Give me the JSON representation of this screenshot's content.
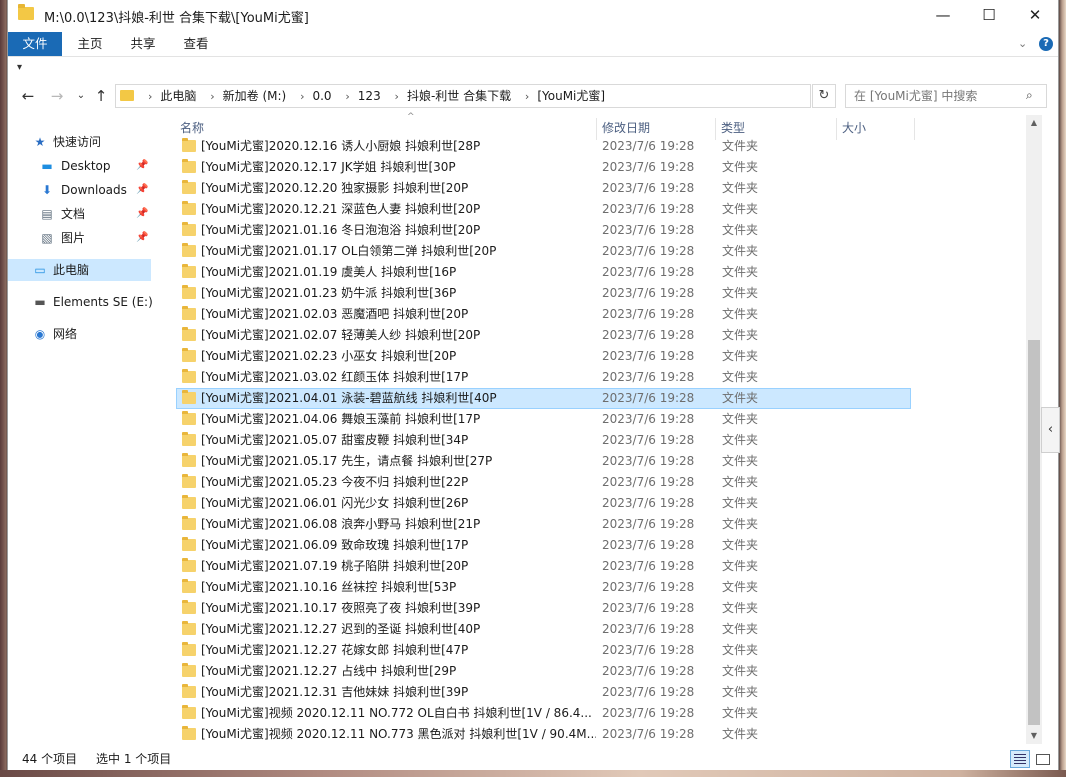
{
  "window": {
    "title": "M:\\0.0\\123\\抖娘-利世 合集下载\\[YouMi尤蜜]",
    "controls": {
      "minimize": "—",
      "maximize": "☐",
      "close": "✕"
    }
  },
  "ribbon": {
    "tabs": [
      {
        "label": "文件",
        "active": true
      },
      {
        "label": "主页",
        "active": false
      },
      {
        "label": "共享",
        "active": false
      },
      {
        "label": "查看",
        "active": false
      }
    ],
    "expand": "⌄",
    "help": "?"
  },
  "qat": {
    "arrow": "▾"
  },
  "nav": {
    "back": "←",
    "forward": "→",
    "recent": "⌄",
    "up": "↑",
    "breadcrumbs": [
      "此电脑",
      "新加卷 (M:)",
      "0.0",
      "123",
      "抖娘-利世 合集下载",
      "[YouMi尤蜜]"
    ],
    "crumb_sep": "›",
    "address_dropdown": "⌄",
    "refresh": "↻",
    "search_placeholder": "在 [YouMi尤蜜] 中搜索",
    "search_value": "",
    "search_icon": "⌕"
  },
  "sidebar": {
    "items": [
      {
        "label": "快速访问",
        "icon": "★",
        "icon_color": "#2a6dc2",
        "pinned": false,
        "selected": false
      },
      {
        "label": "Desktop",
        "icon": "▬",
        "icon_color": "#1e8ee0",
        "pinned": true,
        "selected": false
      },
      {
        "label": "Downloads",
        "icon": "⬇",
        "icon_color": "#2a78d2",
        "pinned": true,
        "selected": false
      },
      {
        "label": "文档",
        "icon": "▤",
        "icon_color": "#5a6a7a",
        "pinned": true,
        "selected": false
      },
      {
        "label": "图片",
        "icon": "▧",
        "icon_color": "#5a6a7a",
        "pinned": true,
        "selected": false
      },
      {
        "label": "此电脑",
        "icon": "▭",
        "icon_color": "#1e8ee0",
        "pinned": false,
        "selected": true
      },
      {
        "label": "Elements SE (E:)",
        "icon": "▬",
        "icon_color": "#555555",
        "pinned": false,
        "selected": false
      },
      {
        "label": "网络",
        "icon": "◉",
        "icon_color": "#2a78d2",
        "pinned": false,
        "selected": false
      }
    ],
    "pin_glyph": "📌"
  },
  "list": {
    "columns": {
      "name": "名称",
      "date": "修改日期",
      "type": "类型",
      "size": "大小"
    },
    "sort_arrow": "^",
    "rows": [
      {
        "name": "[YouMi尤蜜]2020.12.16 诱人小厨娘 抖娘利世[28P",
        "date": "2023/7/6 19:28",
        "type": "文件夹"
      },
      {
        "name": "[YouMi尤蜜]2020.12.17 JK学姐 抖娘利世[30P",
        "date": "2023/7/6 19:28",
        "type": "文件夹"
      },
      {
        "name": "[YouMi尤蜜]2020.12.20 独家摄影 抖娘利世[20P",
        "date": "2023/7/6 19:28",
        "type": "文件夹"
      },
      {
        "name": "[YouMi尤蜜]2020.12.21 深蓝色人妻 抖娘利世[20P",
        "date": "2023/7/6 19:28",
        "type": "文件夹"
      },
      {
        "name": "[YouMi尤蜜]2021.01.16 冬日泡泡浴 抖娘利世[20P",
        "date": "2023/7/6 19:28",
        "type": "文件夹"
      },
      {
        "name": "[YouMi尤蜜]2021.01.17 OL白领第二弹 抖娘利世[20P",
        "date": "2023/7/6 19:28",
        "type": "文件夹"
      },
      {
        "name": "[YouMi尤蜜]2021.01.19 虞美人 抖娘利世[16P",
        "date": "2023/7/6 19:28",
        "type": "文件夹"
      },
      {
        "name": "[YouMi尤蜜]2021.01.23 奶牛派 抖娘利世[36P",
        "date": "2023/7/6 19:28",
        "type": "文件夹"
      },
      {
        "name": "[YouMi尤蜜]2021.02.03 恶魔酒吧 抖娘利世[20P",
        "date": "2023/7/6 19:28",
        "type": "文件夹"
      },
      {
        "name": "[YouMi尤蜜]2021.02.07 轻薄美人纱 抖娘利世[20P",
        "date": "2023/7/6 19:28",
        "type": "文件夹"
      },
      {
        "name": "[YouMi尤蜜]2021.02.23 小巫女 抖娘利世[20P",
        "date": "2023/7/6 19:28",
        "type": "文件夹"
      },
      {
        "name": "[YouMi尤蜜]2021.03.02 红颜玉体 抖娘利世[17P",
        "date": "2023/7/6 19:28",
        "type": "文件夹"
      },
      {
        "name": "[YouMi尤蜜]2021.04.01 泳装-碧蓝航线 抖娘利世[40P",
        "date": "2023/7/6 19:28",
        "type": "文件夹",
        "selected": true
      },
      {
        "name": "[YouMi尤蜜]2021.04.06 舞娘玉藻前 抖娘利世[17P",
        "date": "2023/7/6 19:28",
        "type": "文件夹"
      },
      {
        "name": "[YouMi尤蜜]2021.05.07 甜蜜皮鞭 抖娘利世[34P",
        "date": "2023/7/6 19:28",
        "type": "文件夹"
      },
      {
        "name": "[YouMi尤蜜]2021.05.17 先生，请点餐 抖娘利世[27P",
        "date": "2023/7/6 19:28",
        "type": "文件夹"
      },
      {
        "name": "[YouMi尤蜜]2021.05.23 今夜不归 抖娘利世[22P",
        "date": "2023/7/6 19:28",
        "type": "文件夹"
      },
      {
        "name": "[YouMi尤蜜]2021.06.01 闪光少女 抖娘利世[26P",
        "date": "2023/7/6 19:28",
        "type": "文件夹"
      },
      {
        "name": "[YouMi尤蜜]2021.06.08 浪奔小野马 抖娘利世[21P",
        "date": "2023/7/6 19:28",
        "type": "文件夹"
      },
      {
        "name": "[YouMi尤蜜]2021.06.09 致命玫瑰 抖娘利世[17P",
        "date": "2023/7/6 19:28",
        "type": "文件夹"
      },
      {
        "name": "[YouMi尤蜜]2021.07.19 桃子陷阱 抖娘利世[20P",
        "date": "2023/7/6 19:28",
        "type": "文件夹"
      },
      {
        "name": "[YouMi尤蜜]2021.10.16 丝袜控 抖娘利世[53P",
        "date": "2023/7/6 19:28",
        "type": "文件夹"
      },
      {
        "name": "[YouMi尤蜜]2021.10.17 夜照亮了夜 抖娘利世[39P",
        "date": "2023/7/6 19:28",
        "type": "文件夹"
      },
      {
        "name": "[YouMi尤蜜]2021.12.27 迟到的圣诞 抖娘利世[40P",
        "date": "2023/7/6 19:28",
        "type": "文件夹"
      },
      {
        "name": "[YouMi尤蜜]2021.12.27 花嫁女郎 抖娘利世[47P",
        "date": "2023/7/6 19:28",
        "type": "文件夹"
      },
      {
        "name": "[YouMi尤蜜]2021.12.27 占线中 抖娘利世[29P",
        "date": "2023/7/6 19:28",
        "type": "文件夹"
      },
      {
        "name": "[YouMi尤蜜]2021.12.31 吉他妹妹 抖娘利世[39P",
        "date": "2023/7/6 19:28",
        "type": "文件夹"
      },
      {
        "name": "[YouMi尤蜜]视频 2020.12.11 NO.772 OL自白书 抖娘利世[1V / 86.4...",
        "date": "2023/7/6 19:28",
        "type": "文件夹"
      },
      {
        "name": "[YouMi尤蜜]视频 2020.12.11 NO.773 黑色派对 抖娘利世[1V / 90.4M...",
        "date": "2023/7/6 19:28",
        "type": "文件夹"
      }
    ]
  },
  "scrollbar": {
    "up": "▲",
    "down": "▼",
    "side_tab": "‹"
  },
  "status": {
    "count": "44 个项目",
    "selected": "选中 1 个项目"
  }
}
